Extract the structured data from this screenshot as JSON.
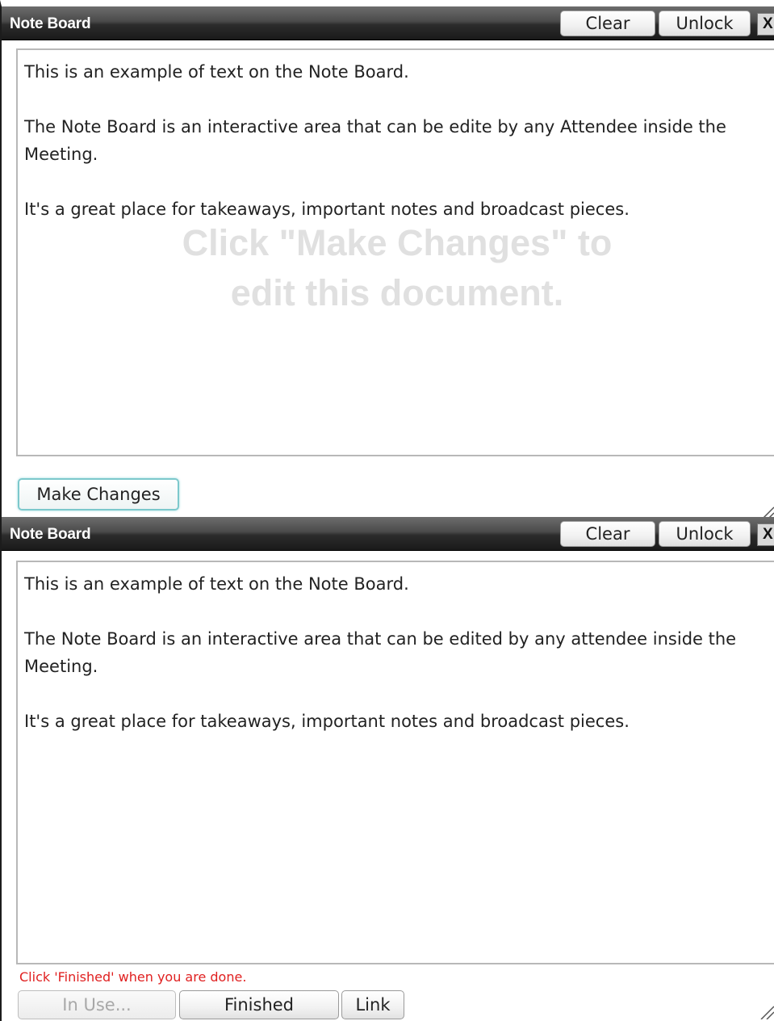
{
  "panels": [
    {
      "title": "Note Board",
      "clear_label": "Clear",
      "unlock_label": "Unlock",
      "close_label": "X",
      "paragraphs": [
        "This is an example of text on the Note Board.",
        "The Note Board is an interactive area that can be edite by any Attendee inside the Meeting.",
        "It's a great place for takeaways, important notes and broadcast pieces."
      ],
      "watermark_lines": [
        "Click \"Make Changes\" to",
        "edit this document."
      ],
      "make_changes_label": "Make Changes",
      "resize_grip_icon": "resize-grip-icon"
    },
    {
      "title": "Note Board",
      "clear_label": "Clear",
      "unlock_label": "Unlock",
      "close_label": "X",
      "paragraphs": [
        "This is an example of text on the Note Board.",
        "The Note Board is an interactive area that can be edited by any attendee inside the Meeting.",
        "It's a great place for takeaways, important notes and broadcast pieces."
      ],
      "hint": "Click 'Finished' when you are done.",
      "in_use_label": "In Use...",
      "finished_label": "Finished",
      "link_label": "Link",
      "resize_grip_icon": "resize-grip-icon"
    }
  ],
  "colors": {
    "titlebar": "#2c2c2c",
    "hint": "#e02020",
    "make_changes_border": "#7cc8cc",
    "watermark": "#e0e0e0"
  }
}
